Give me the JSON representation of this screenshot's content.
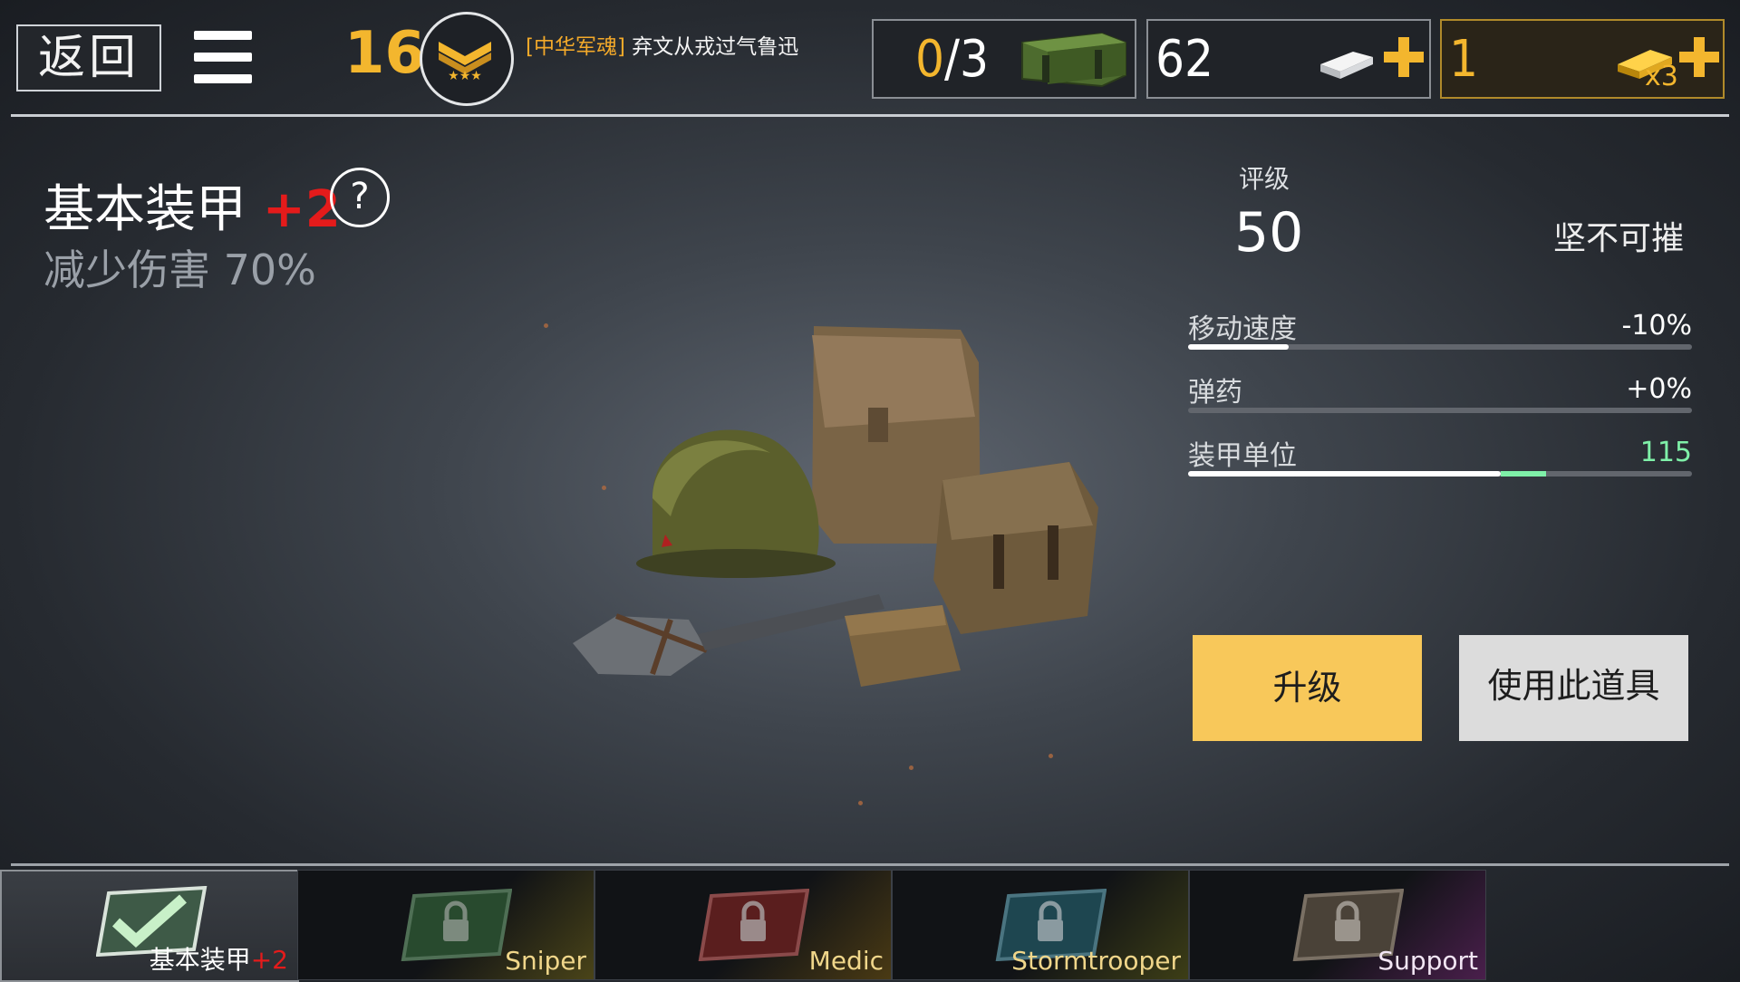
{
  "header": {
    "back_label": "返回",
    "level": "16",
    "player_clan": "[中华军魂]",
    "player_name": "弃文从戎过气鲁迅",
    "crates_current": "0",
    "crates_total": "/3",
    "silver": "62",
    "gold": "1",
    "gold_multiplier": "x3"
  },
  "item": {
    "name": "基本装甲",
    "level_bonus": "+2",
    "effect": "减少伤害 70%",
    "help_symbol": "?"
  },
  "stats_panel": {
    "rating_label": "评级",
    "rating_value": "50",
    "rating_desc": "坚不可摧",
    "stats": [
      {
        "name": "移动速度",
        "value": "-10%",
        "fill": 0.2
      },
      {
        "name": "弹药",
        "value": "+0%",
        "fill": 0.0
      },
      {
        "name": "装甲单位",
        "value": "115",
        "fill": 0.62,
        "gain": 0.09,
        "value_color": "#7ff0a8"
      }
    ]
  },
  "actions": {
    "upgrade_label": "升级",
    "use_label": "使用此道具"
  },
  "tabs": [
    {
      "label": "基本装甲",
      "bonus": "+2",
      "locked": false,
      "active": true
    },
    {
      "label": "Sniper",
      "locked": true
    },
    {
      "label": "Medic",
      "locked": true
    },
    {
      "label": "Stormtrooper",
      "locked": true
    },
    {
      "label": "Support",
      "locked": true
    }
  ],
  "colors": {
    "accent_gold": "#f3b62e",
    "upgrade_button": "#f8c85a",
    "bonus_red": "#e41b1b",
    "stat_gain": "#7ff0a8"
  },
  "icons": [
    "menu-icon",
    "rank-badge-icon",
    "ammo-crate-icon",
    "silver-bar-icon",
    "gold-bar-icon",
    "help-icon",
    "checkmark-card-icon",
    "lock-icon"
  ]
}
